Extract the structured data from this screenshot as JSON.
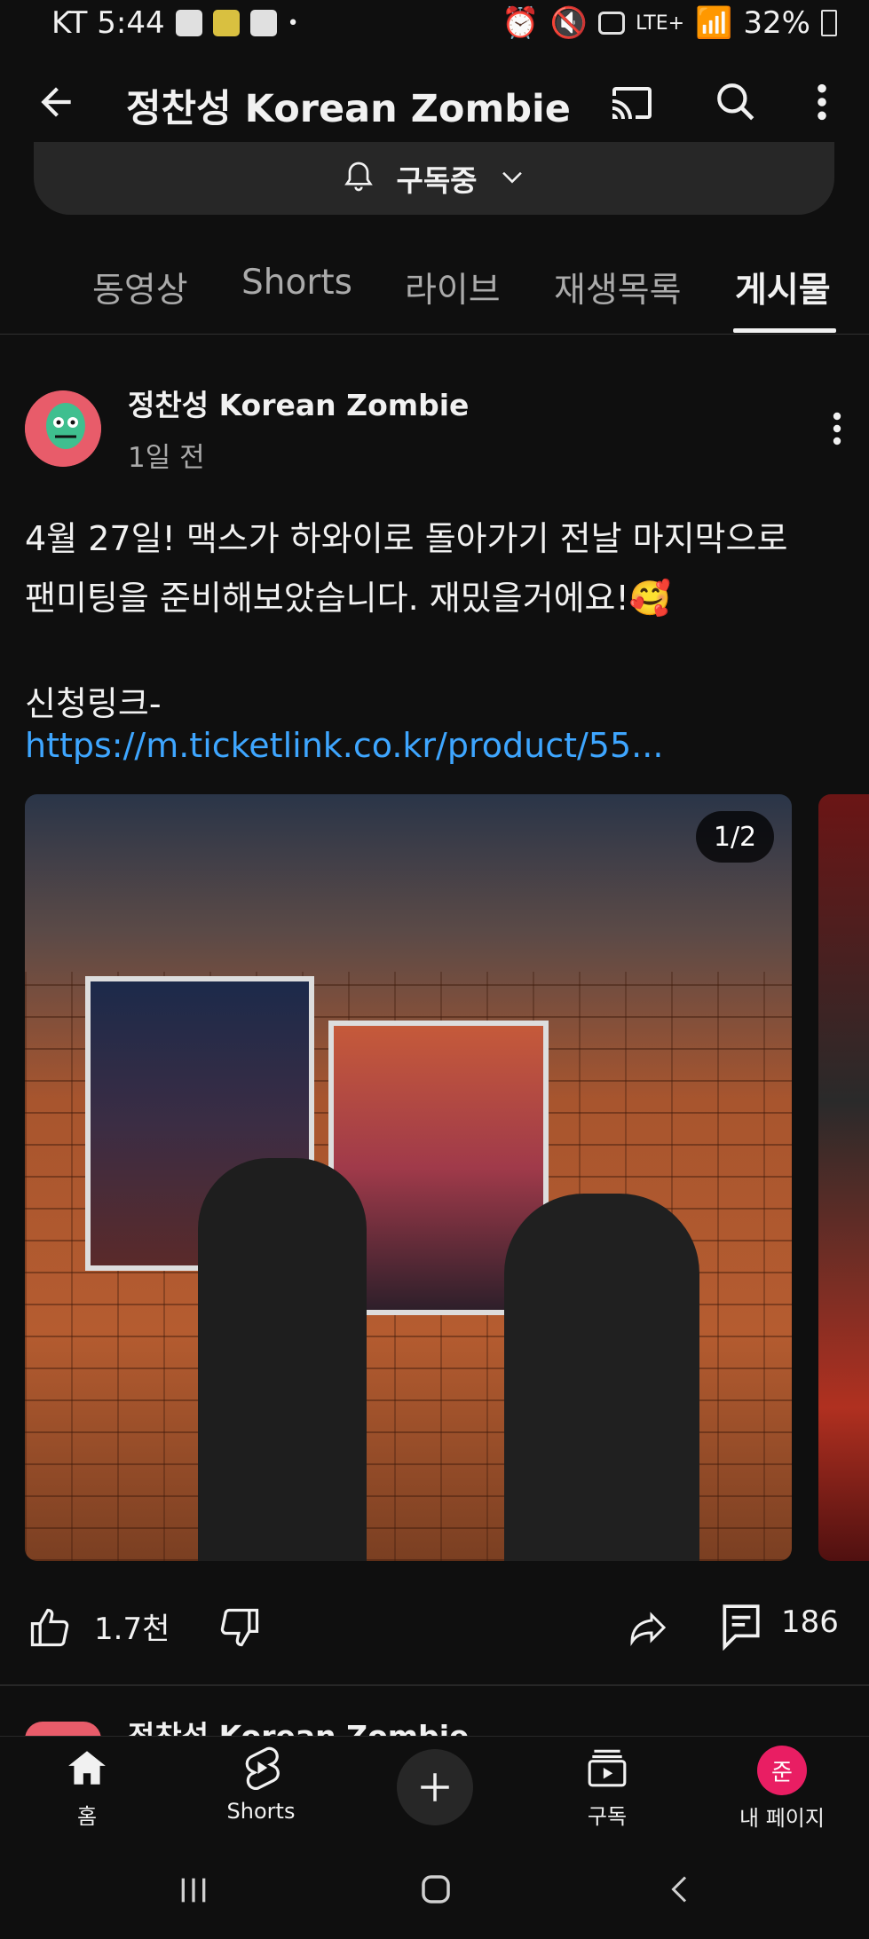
{
  "status_bar": {
    "carrier_time": "KT 5:44",
    "network": "LTE+",
    "battery": "32%"
  },
  "app_bar": {
    "title": "정찬성 Korean Zombie",
    "icons": [
      "back-arrow-icon",
      "cast-icon",
      "search-icon",
      "more-vert-icon"
    ]
  },
  "subscribe": {
    "label": "구독중",
    "icons": [
      "bell-icon",
      "chevron-down-icon"
    ]
  },
  "tabs": [
    {
      "label": "동영상",
      "active": false
    },
    {
      "label": "Shorts",
      "active": false
    },
    {
      "label": "라이브",
      "active": false
    },
    {
      "label": "재생목록",
      "active": false
    },
    {
      "label": "게시물",
      "active": true
    }
  ],
  "post": {
    "author": "정찬성 Korean Zombie",
    "time": "1일 전",
    "text_line1": "4월 27일! 맥스가 하와이로 돌아가기 전날 마지막으로",
    "text_line2": "팬미팅을 준비해보았습니다. 재밌을거에요!🥰",
    "link_label": "신청링크-",
    "link_url": "https://m.ticketlink.co.kr/product/55...",
    "image_counter": "1/2",
    "likes": "1.7천",
    "comments": "186"
  },
  "next_post": {
    "author": "정찬성 Korean Zombie"
  },
  "bottom_nav": {
    "items": [
      {
        "label": "홈",
        "icon": "home-icon"
      },
      {
        "label": "Shorts",
        "icon": "shorts-icon"
      },
      {
        "label": "",
        "icon": "create-plus-icon"
      },
      {
        "label": "구독",
        "icon": "subscriptions-icon"
      },
      {
        "label": "내 페이지",
        "icon": "avatar-icon",
        "avatar_letter": "준"
      }
    ]
  },
  "colors": {
    "background": "#0f0f0f",
    "link": "#3ea6ff",
    "avatar_pink": "#e91e63"
  }
}
